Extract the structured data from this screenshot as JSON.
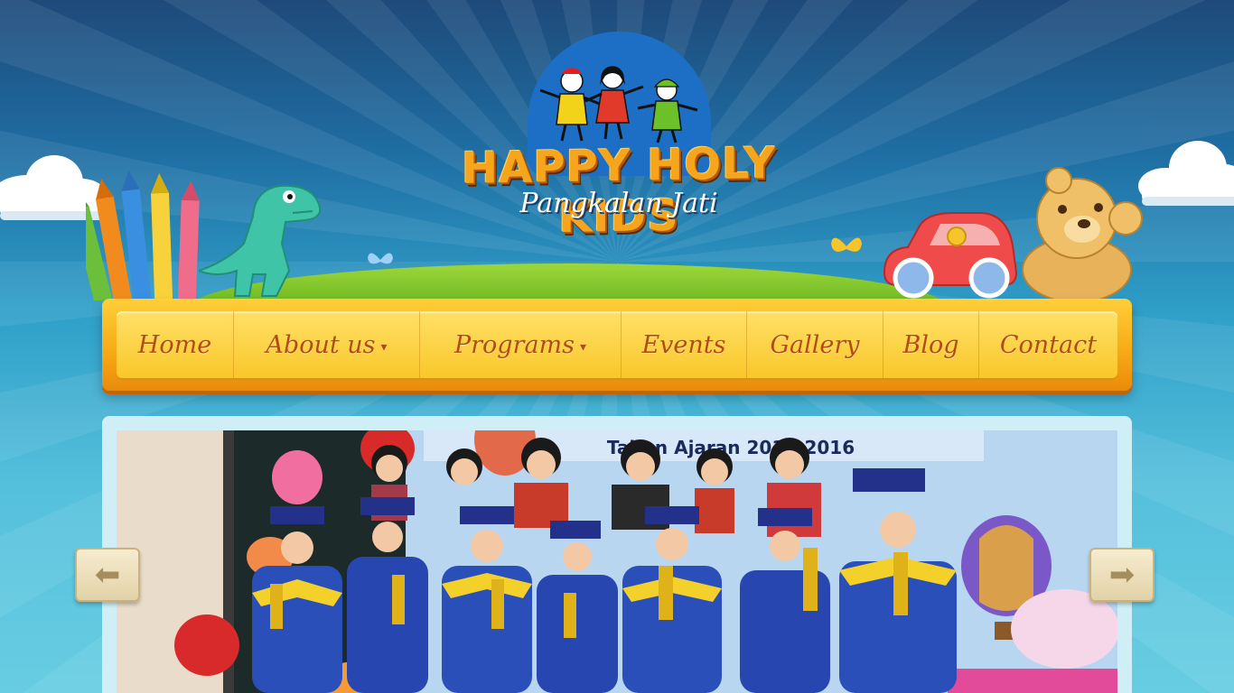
{
  "site": {
    "logo_title": "HAPPY HOLY KIDS",
    "logo_subtitle": "Pangkalan Jati"
  },
  "nav": {
    "items": [
      {
        "label": "Home",
        "has_dropdown": false
      },
      {
        "label": "About us",
        "has_dropdown": true
      },
      {
        "label": "Programs",
        "has_dropdown": true
      },
      {
        "label": "Events",
        "has_dropdown": false
      },
      {
        "label": "Gallery",
        "has_dropdown": false
      },
      {
        "label": "Blog",
        "has_dropdown": false
      },
      {
        "label": "Contact",
        "has_dropdown": false
      }
    ],
    "dropdown_glyph": "▾"
  },
  "slider": {
    "banner_text": "Tahun Ajaran 2015-2016",
    "prev_icon": "arrow-left-icon",
    "next_icon": "arrow-right-icon",
    "prev_glyph": "⬅",
    "next_glyph": "➡"
  },
  "decor": {
    "crayon_label": "CRAYON"
  },
  "colors": {
    "nav_text": "#b34d0e",
    "nav_bg": "#f9c72a",
    "logo_orange": "#f6a51c",
    "sky_top": "#1e4a7a",
    "sky_bottom": "#67cde2"
  }
}
